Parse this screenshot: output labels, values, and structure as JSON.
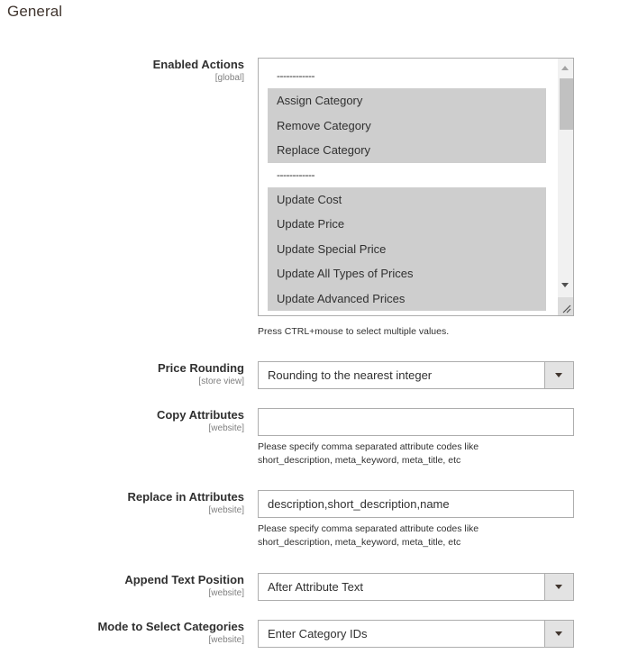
{
  "section": {
    "title": "General"
  },
  "enabled_actions": {
    "label": "Enabled Actions",
    "scope": "[global]",
    "options": [
      {
        "label": "------------",
        "selected": false,
        "separator": true
      },
      {
        "label": "Assign Category",
        "selected": true
      },
      {
        "label": "Remove Category",
        "selected": true
      },
      {
        "label": "Replace Category",
        "selected": true
      },
      {
        "label": "------------",
        "selected": false,
        "separator": true
      },
      {
        "label": "Update Cost",
        "selected": true
      },
      {
        "label": "Update Price",
        "selected": true
      },
      {
        "label": "Update Special Price",
        "selected": true
      },
      {
        "label": "Update All Types of Prices",
        "selected": true
      },
      {
        "label": "Update Advanced Prices",
        "selected": true
      }
    ],
    "hint": "Press CTRL+mouse to select multiple values."
  },
  "price_rounding": {
    "label": "Price Rounding",
    "scope": "[store view]",
    "value": "Rounding to the nearest integer"
  },
  "copy_attributes": {
    "label": "Copy Attributes",
    "scope": "[website]",
    "value": "",
    "hint_line1": "Please specify comma separated attribute codes like",
    "hint_line2": "short_description, meta_keyword, meta_title, etc"
  },
  "replace_in_attributes": {
    "label": "Replace in Attributes",
    "scope": "[website]",
    "value": "description,short_description,name",
    "hint_line1": "Please specify comma separated attribute codes like",
    "hint_line2": "short_description, meta_keyword, meta_title, etc"
  },
  "append_text_position": {
    "label": "Append Text Position",
    "scope": "[website]",
    "value": "After Attribute Text"
  },
  "mode_select_categories": {
    "label": "Mode to Select Categories",
    "scope": "[website]",
    "value": "Enter Category IDs"
  },
  "colors": {
    "selected_option_bg": "#cecece",
    "border": "#adadad",
    "select_button_bg": "#e3e3e3"
  }
}
